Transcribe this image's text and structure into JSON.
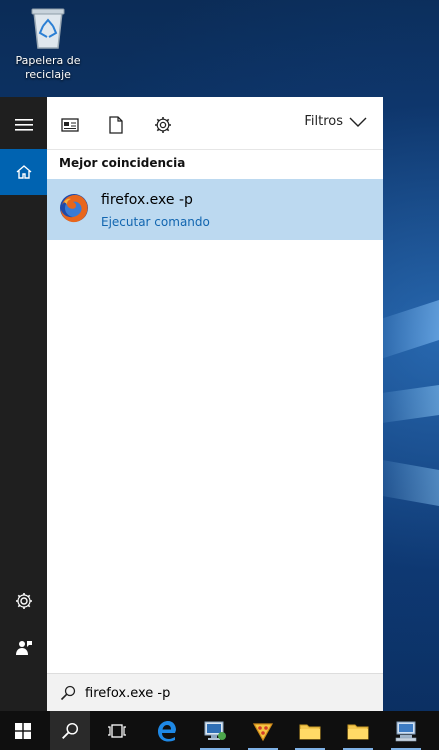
{
  "desktop": {
    "recycle_bin_label_line1": "Papelera de",
    "recycle_bin_label_line2": "reciclaje"
  },
  "rail": {
    "items": [
      "hamburger-menu",
      "home",
      "settings",
      "feedback"
    ]
  },
  "toolbar": {
    "filters_label": "Filtros"
  },
  "results": {
    "section_title": "Mejor coincidencia",
    "best_match": {
      "title": "firefox.exe -p",
      "subtitle": "Ejecutar comando"
    }
  },
  "search": {
    "value": "firefox.exe -p"
  },
  "colors": {
    "selection": "#bcd9f0",
    "link": "#1266b0",
    "rail": "#1f1f1f",
    "taskbar": "#0f0f0f"
  }
}
